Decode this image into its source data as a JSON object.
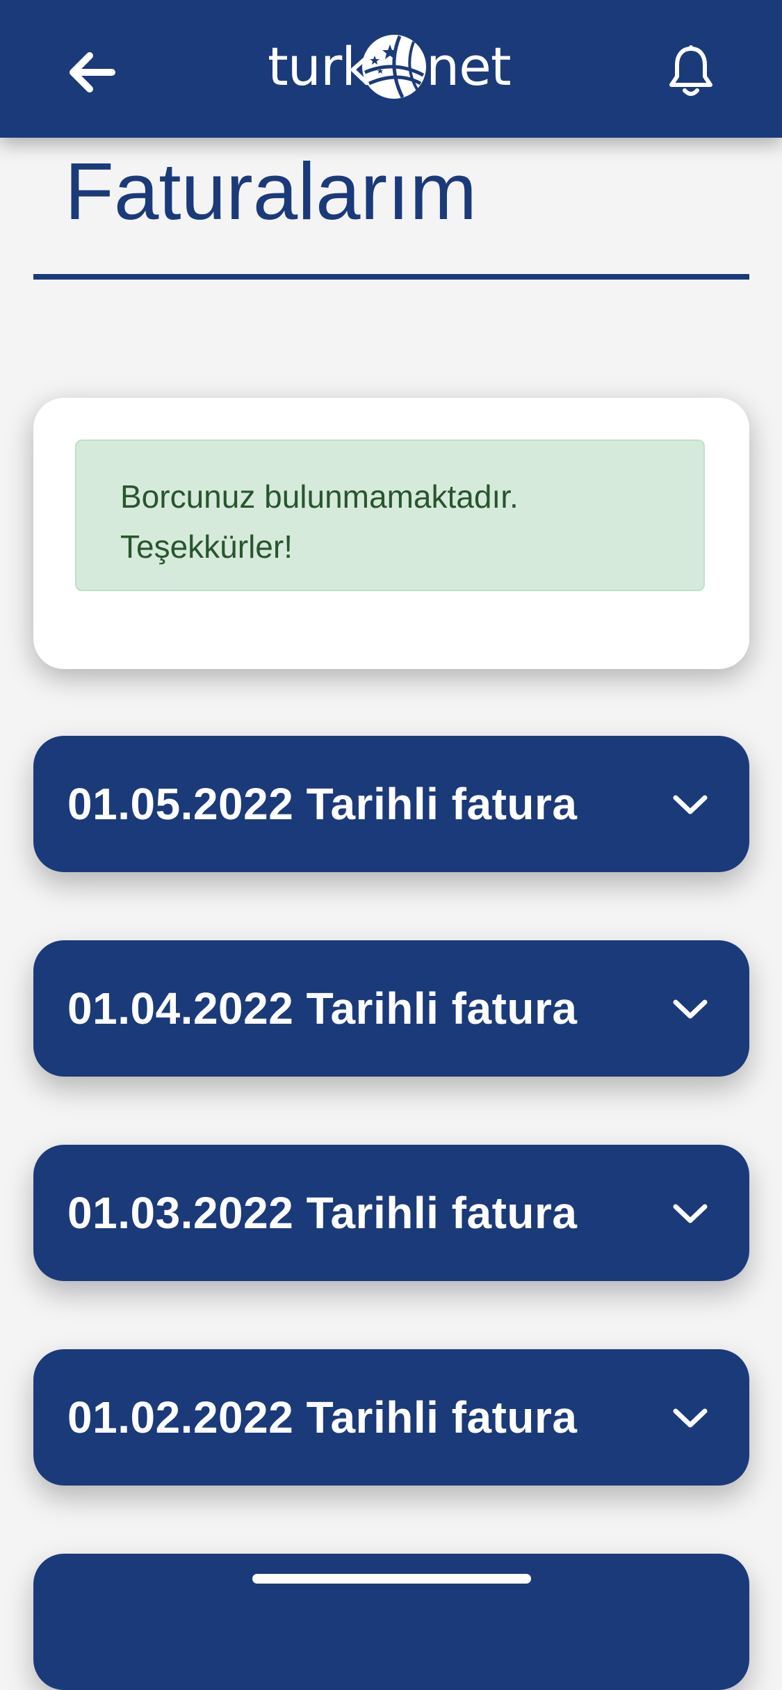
{
  "header": {
    "logo_left": "turk",
    "logo_right": "net",
    "back_icon": "arrow-left-icon",
    "bell_icon": "bell-icon",
    "logo_icon": "globe-icon",
    "background_color": "#1b3a7a"
  },
  "page": {
    "title": "Faturalarım"
  },
  "status": {
    "line1": "Borcunuz bulunmamaktadır.",
    "line2": "Teşekkürler!"
  },
  "invoices": [
    {
      "label": "01.05.2022 Tarihli fatura"
    },
    {
      "label": "01.04.2022 Tarihli fatura"
    },
    {
      "label": "01.03.2022 Tarihli fatura"
    },
    {
      "label": "01.02.2022 Tarihli fatura"
    },
    {
      "label": ""
    }
  ],
  "colors": {
    "brand_blue": "#1b3a7a",
    "success_bg": "#d6eadb",
    "success_text": "#28552e"
  }
}
